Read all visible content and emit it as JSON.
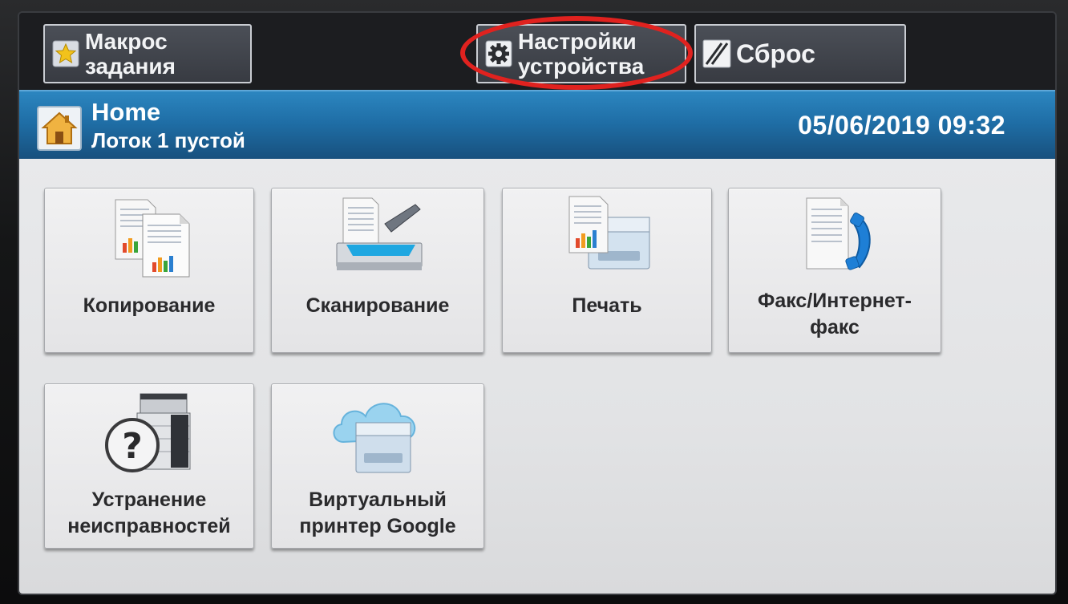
{
  "topbar": {
    "macro": {
      "label": "Макрос\nзадания",
      "icon": "star-icon"
    },
    "settings": {
      "label": "Настройки\nустройства",
      "icon": "gear-icon"
    },
    "reset": {
      "label": "Сброс",
      "icon": "reset-slash-icon"
    }
  },
  "header": {
    "title": "Home",
    "status": "Лоток 1 пустой",
    "datetime": "05/06/2019 09:32",
    "icon": "home-icon"
  },
  "tiles": [
    {
      "label": "Копирование",
      "icon": "copy-icon"
    },
    {
      "label": "Сканирование",
      "icon": "scan-icon"
    },
    {
      "label": "Печать",
      "icon": "print-icon"
    },
    {
      "label": "Факс/Интернет-\nфакс",
      "icon": "fax-icon"
    },
    {
      "label": "Устранение\nнеисправностей",
      "icon": "troubleshoot-icon"
    },
    {
      "label": "Виртуальный\nпринтер Google",
      "icon": "cloud-printer-icon"
    }
  ],
  "colors": {
    "header_blue": "#1f6ea6",
    "highlight_ring": "#e0221f",
    "button_dark": "#3d4047",
    "tile_bg": "#ececee"
  }
}
